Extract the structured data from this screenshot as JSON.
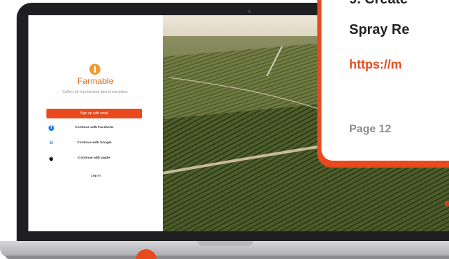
{
  "login": {
    "brand": "Farmable",
    "tagline": "Collect all your farming data in one place.",
    "signup_label": "Sign up with email",
    "facebook_label": "Continue with Facebook",
    "google_label": "Continue with Google",
    "apple_label": "Continue with Apple",
    "login_label": "Log in",
    "icons": {
      "logo": "farmable-logo-icon",
      "facebook": "facebook-icon",
      "google": "google-icon",
      "apple": "apple-icon"
    }
  },
  "callout": {
    "title_line1": "9. Create",
    "title_line2": "Spray Re",
    "url": "https://m",
    "page_label": "Page",
    "page_number": "12"
  },
  "colors": {
    "accent": "#e8491d",
    "brand": "#e06a1f",
    "laptop_bezel": "#1f1f22",
    "facebook": "#1877f2",
    "google": "#4285f4"
  }
}
